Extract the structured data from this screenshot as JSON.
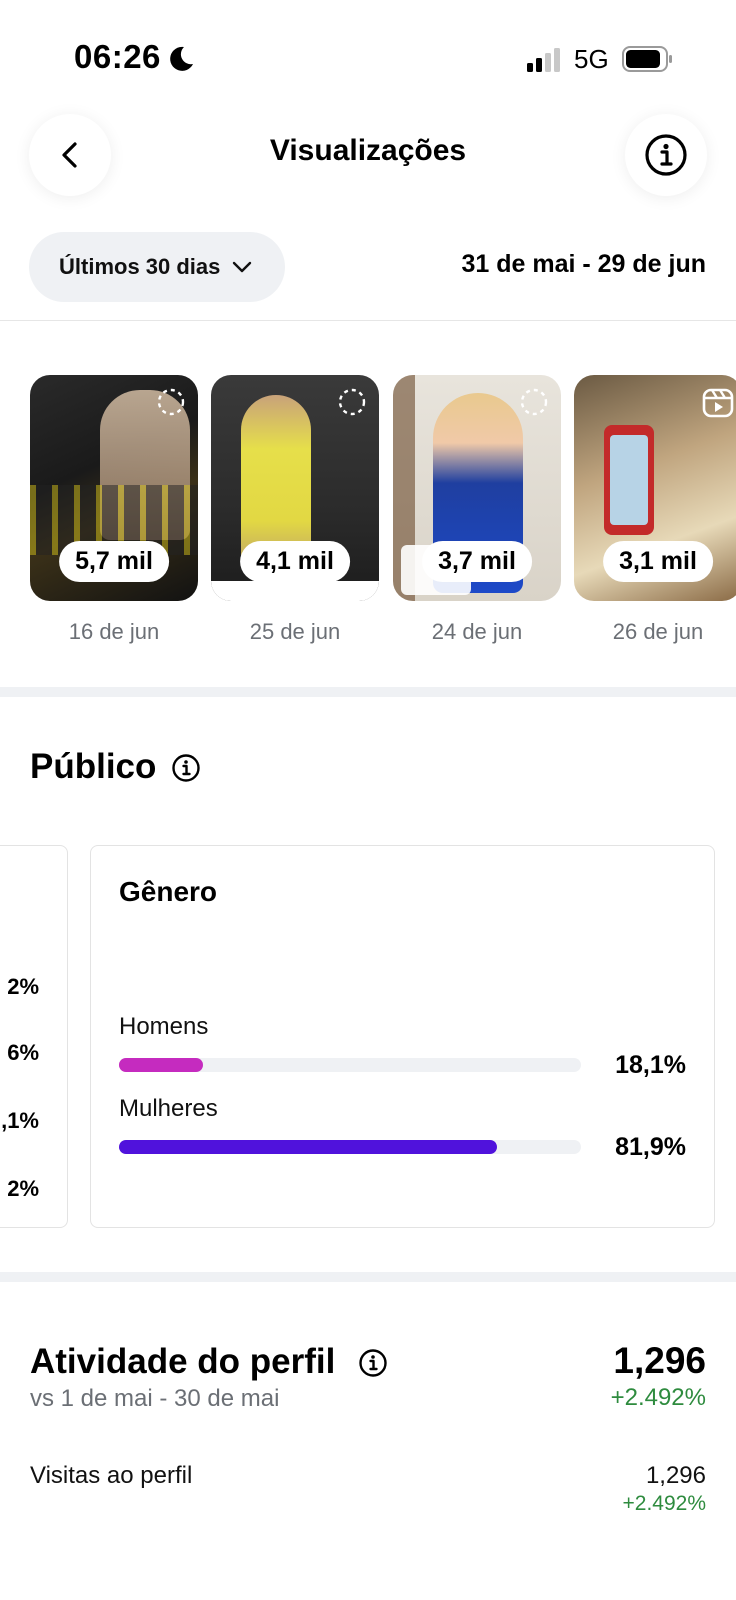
{
  "status_bar": {
    "time": "06:26",
    "network": "5G"
  },
  "header": {
    "title": "Visualizações"
  },
  "filter": {
    "period_label": "Últimos 30 dias",
    "date_range": "31 de mai - 29 de jun"
  },
  "stories": [
    {
      "views": "5,7 mil",
      "date": "16 de jun"
    },
    {
      "views": "4,1 mil",
      "date": "25 de jun"
    },
    {
      "views": "3,7 mil",
      "date": "24 de jun"
    },
    {
      "views": "3,1 mil",
      "date": "26 de jun"
    }
  ],
  "audience": {
    "title": "Público",
    "left_card_percents": [
      "2%",
      "6%",
      ",1%",
      "2%"
    ],
    "gender": {
      "title": "Gênero",
      "bars": [
        {
          "label": "Homens",
          "value": "18,1%",
          "fraction": 0.181,
          "color": "#c52bbf"
        },
        {
          "label": "Mulheres",
          "value": "81,9%",
          "fraction": 0.819,
          "color": "#5012dc"
        }
      ]
    }
  },
  "activity": {
    "title": "Atividade do perfil",
    "comparison": "vs 1 de mai - 30 de mai",
    "total": "1,296",
    "change": "+2.492%",
    "rows": [
      {
        "label": "Visitas ao perfil",
        "value": "1,296",
        "change": "+2.492%"
      }
    ]
  },
  "colors": {
    "positive_change": "#2e8b3e",
    "men_bar": "#c52bbf",
    "women_bar": "#5012dc"
  }
}
